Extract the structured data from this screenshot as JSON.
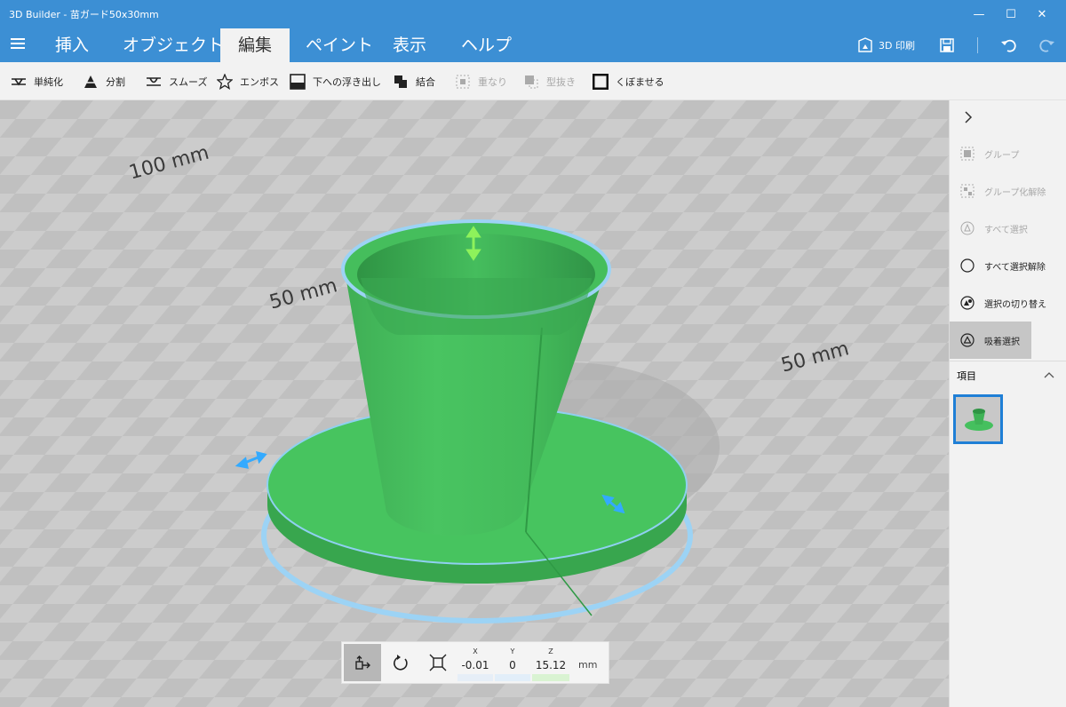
{
  "window": {
    "title": "3D Builder - 苗ガード50x30mm",
    "minimize_label": "—",
    "maximize_label": "☐",
    "close_label": "✕"
  },
  "menu": {
    "tabs": [
      {
        "label": "挿入"
      },
      {
        "label": "オブジェクト"
      },
      {
        "label": "編集"
      },
      {
        "label": "ペイント"
      },
      {
        "label": "表示"
      },
      {
        "label": "ヘルプ"
      }
    ],
    "active_tab": "編集",
    "print_label": "3D 印刷"
  },
  "toolbar": {
    "items": [
      {
        "label": "単純化",
        "icon": "simplify-icon",
        "enabled": true
      },
      {
        "label": "分割",
        "icon": "split-icon",
        "enabled": true
      },
      {
        "label": "スムーズ",
        "icon": "smooth-icon",
        "enabled": true
      },
      {
        "label": "エンボス",
        "icon": "star-icon",
        "enabled": true
      },
      {
        "label": "下への浮き出し",
        "icon": "extrude-down-icon",
        "enabled": true
      },
      {
        "label": "結合",
        "icon": "merge-icon",
        "enabled": true
      },
      {
        "label": "重なり",
        "icon": "intersect-icon",
        "enabled": false
      },
      {
        "label": "型抜き",
        "icon": "subtract-icon",
        "enabled": false
      },
      {
        "label": "くぼませる",
        "icon": "hollow-icon",
        "enabled": true
      }
    ]
  },
  "viewport": {
    "grid_labels": [
      "100 mm",
      "50 mm",
      "50 mm"
    ]
  },
  "transform": {
    "x_label": "X",
    "x_value": "-0.01",
    "y_label": "Y",
    "y_value": "0",
    "z_label": "Z",
    "z_value": "15.12",
    "unit": "mm"
  },
  "side_panel": {
    "items": [
      {
        "label": "グループ",
        "icon": "group-icon",
        "enabled": false
      },
      {
        "label": "グループ化解除",
        "icon": "ungroup-icon",
        "enabled": false
      },
      {
        "label": "すべて選択",
        "icon": "select-all-icon",
        "enabled": false
      },
      {
        "label": "すべて選択解除",
        "icon": "deselect-all-icon",
        "enabled": true
      },
      {
        "label": "選択の切り替え",
        "icon": "toggle-selection-icon",
        "enabled": true
      },
      {
        "label": "吸着選択",
        "icon": "snap-select-icon",
        "enabled": true,
        "active": true
      }
    ],
    "objects_label": "項目"
  },
  "colors": {
    "accent": "#3c8fd4",
    "model_green": "#45c05e",
    "selection_blue": "#1f7fd6"
  }
}
